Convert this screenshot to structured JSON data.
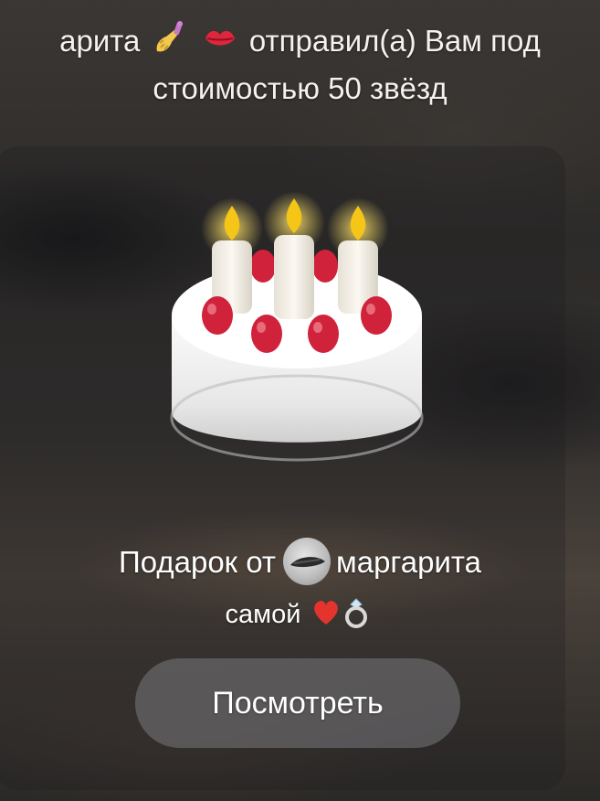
{
  "service_message": {
    "sender_name_part": "арита",
    "sender_emoji_1": "nail-polish-icon",
    "sender_emoji_2": "kiss-mark-icon",
    "action_text": "отправил(а) Вам под",
    "price_text": "стоимостью 50 звёзд"
  },
  "gift": {
    "sticker": "birthday-cake-icon",
    "from_prefix": "Подарок от",
    "from_name": "маргарита",
    "note_text": "самой",
    "note_emoji_1": "red-heart-icon",
    "note_emoji_2": "ring-icon"
  },
  "actions": {
    "view_label": "Посмотреть"
  },
  "colors": {
    "text": "#ffffff",
    "button_bg": "#78787c",
    "candle_flame": "#f5c518",
    "strawberry": "#d0223a"
  }
}
